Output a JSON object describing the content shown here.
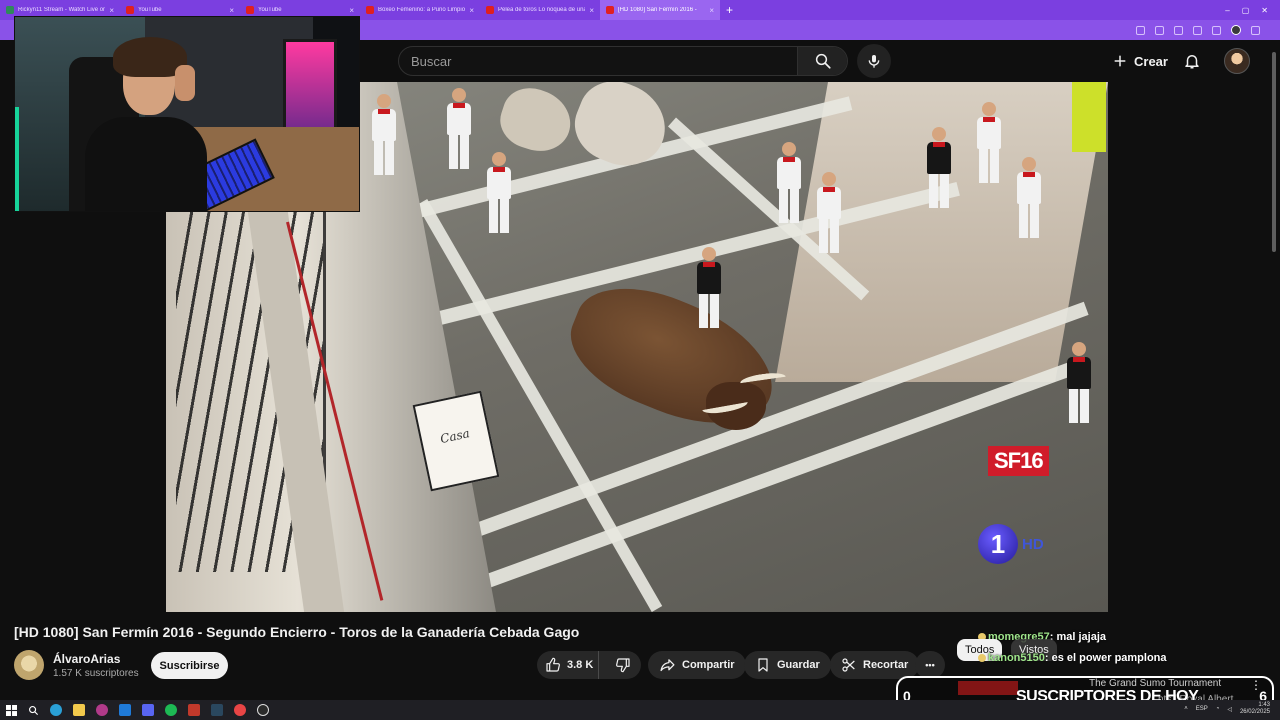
{
  "browser": {
    "tabs": [
      {
        "label": "Rickyn11 Stream - Watch Live on",
        "favicon": "#2f8a5a",
        "active": false
      },
      {
        "label": "YouTube",
        "favicon": "#e02020",
        "active": false
      },
      {
        "label": "YouTube",
        "favicon": "#e02020",
        "active": false
      },
      {
        "label": "Boxeo Femenino: a Puño Limpio",
        "favicon": "#e02020",
        "active": false
      },
      {
        "label": "Pelea de toros Lo noquea de una",
        "favicon": "#e02020",
        "active": false
      },
      {
        "label": "[HD 1080] San Fermín 2016 -",
        "favicon": "#e02020",
        "active": true
      }
    ],
    "new_tab": "+"
  },
  "header": {
    "search_placeholder": "Buscar",
    "create_label": "Crear"
  },
  "video": {
    "overlay_logo": "SF16",
    "channel_logo_number": "1",
    "channel_logo_hd": "HD",
    "sign_text": "Casa"
  },
  "watch": {
    "title": "[HD 1080] San Fermín 2016 - Segundo Encierro - Toros de la Ganadería Cebada Gago",
    "channel": {
      "name": "ÁlvaroArias",
      "subscribers": "1.57 K suscriptores",
      "subscribe_label": "Suscribirse"
    },
    "actions": {
      "likes": "3.8 K",
      "share_label": "Compartir",
      "save_label": "Guardar",
      "clip_label": "Recortar",
      "more_label": "•••"
    }
  },
  "chat": {
    "messages": [
      {
        "user": "momegre57",
        "text": ": mal jajaja"
      },
      {
        "user": "kanon5150",
        "text": ": es el power pamplona"
      }
    ],
    "filter_all": "Todos",
    "filter_seen": "Vistos"
  },
  "subscribers_widget": {
    "left_count": "0",
    "label": "SUSCRIPTORES DE HOY",
    "right_count": "6",
    "behind_title": "The Grand Sumo Tournament",
    "behind_sub": "nts | Royal Albert",
    "menu": "⋮"
  },
  "taskbar": {
    "lang": "ESP",
    "time": "1:43",
    "date": "26/02/2025"
  },
  "colors": {
    "browser_accent": "#7b3fe0",
    "yt_background": "#0f0f0f",
    "subscribe_button": "#f1f1f1",
    "sf_logo": "#d01c2a"
  }
}
